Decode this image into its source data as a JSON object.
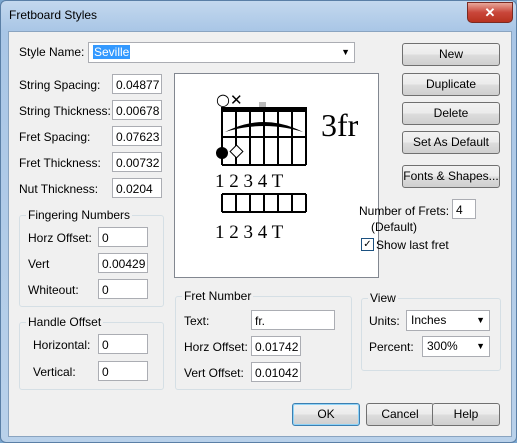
{
  "window": {
    "title": "Fretboard Styles",
    "close_glyph": "✕"
  },
  "style_name": {
    "label": "Style Name:",
    "value": "Seville"
  },
  "spacing": [
    {
      "label": "String Spacing:",
      "value": "0.04877"
    },
    {
      "label": "String Thickness:",
      "value": "0.00678"
    },
    {
      "label": "Fret Spacing:",
      "value": "0.07623"
    },
    {
      "label": "Fret Thickness:",
      "value": "0.00732"
    },
    {
      "label": "Nut Thickness:",
      "value": "0.0204"
    }
  ],
  "fingering": {
    "title": "Fingering Numbers",
    "horz_label": "Horz Offset:",
    "horz_value": "0",
    "vert_label": "Vert",
    "vert_value": "0.00429",
    "whiteout_label": "Whiteout:",
    "whiteout_value": "0"
  },
  "handle": {
    "title": "Handle Offset",
    "horizontal_label": "Horizontal:",
    "horizontal_value": "0",
    "vertical_label": "Vertical:",
    "vertical_value": "0"
  },
  "fret_number": {
    "title": "Fret Number",
    "text_label": "Text:",
    "text_value": "fr.",
    "horz_label": "Horz Offset:",
    "horz_value": "0.01742",
    "vert_label": "Vert Offset:",
    "vert_value": "0.01042"
  },
  "preview": {
    "fret_number_text": "3fr",
    "finger_labels_top": "1 2 3 4 T",
    "finger_labels_bottom": "1 2 3 4 T",
    "open_marker": "○",
    "mute_marker": "✕"
  },
  "buttons": {
    "new": "New",
    "duplicate": "Duplicate",
    "delete": "Delete",
    "set_default": "Set As Default",
    "fonts_shapes": "Fonts & Shapes...",
    "ok": "OK",
    "cancel": "Cancel",
    "help": "Help"
  },
  "frets": {
    "label": "Number of Frets:",
    "value": "4",
    "sublabel": "(Default)",
    "show_last_label": "Show last fret",
    "show_last_checked": true,
    "check_glyph": "✓"
  },
  "view": {
    "title": "View",
    "units_label": "Units:",
    "units_value": "Inches",
    "percent_label": "Percent:",
    "percent_value": "300%"
  }
}
